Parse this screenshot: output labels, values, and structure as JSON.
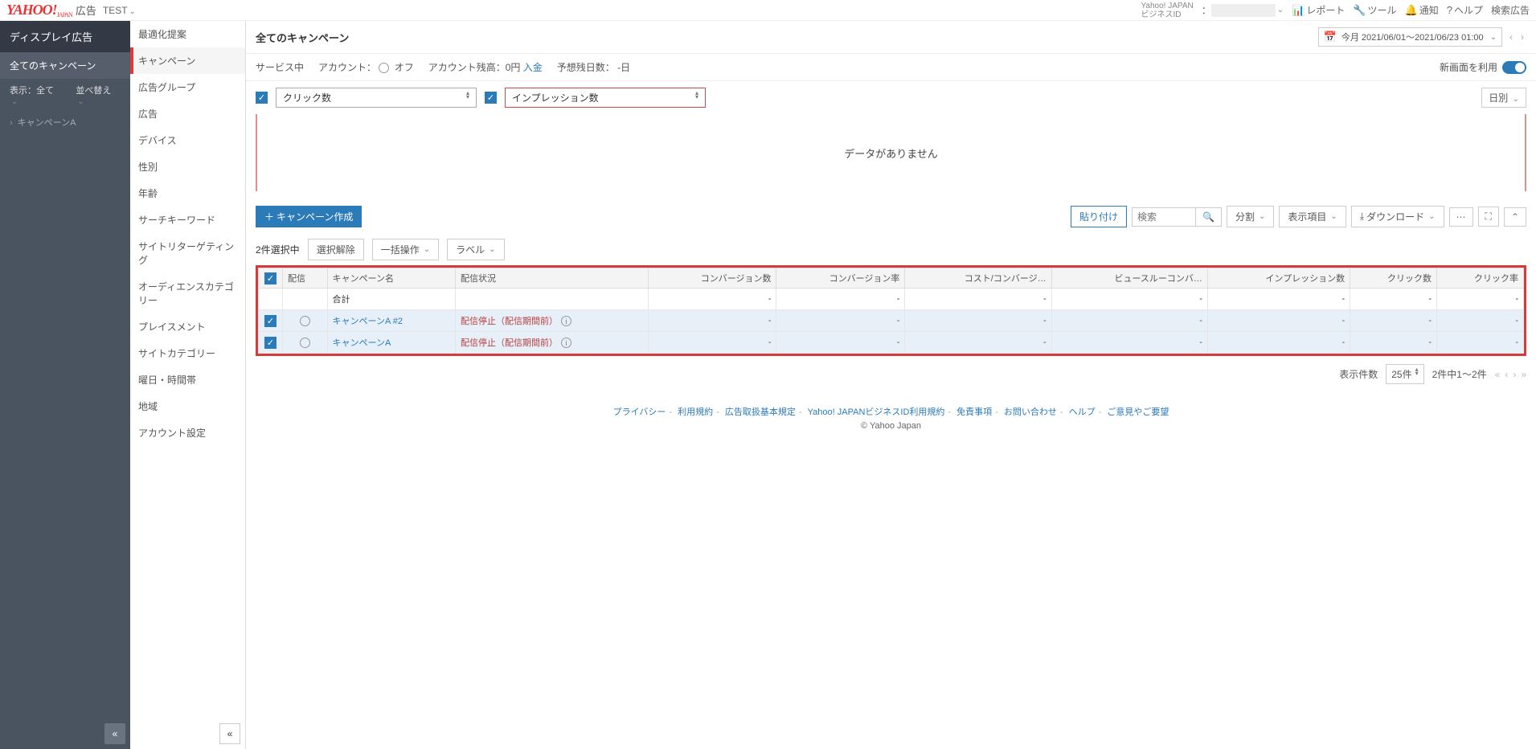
{
  "header": {
    "logo_main": "YAHOO!",
    "logo_sub": "JAPAN",
    "logo_ad": "広告",
    "account_name": "TEST",
    "id_label1": "Yahoo! JAPAN",
    "id_label2": "ビジネスID",
    "links": {
      "report": "レポート",
      "tools": "ツール",
      "notif": "通知",
      "help": "ヘルプ",
      "search_ads": "検索広告"
    }
  },
  "sidebar1": {
    "title": "ディスプレイ広告",
    "subtitle": "全てのキャンペーン",
    "display_label": "表示：全て",
    "sort_label": "並べ替え",
    "breadcrumb": "キャンペーンA"
  },
  "sidebar2": {
    "items": [
      "最適化提案",
      "キャンペーン",
      "広告グループ",
      "広告",
      "デバイス",
      "性別",
      "年齢",
      "サーチキーワード",
      "サイトリターゲティング",
      "オーディエンスカテゴリー",
      "プレイスメント",
      "サイトカテゴリー",
      "曜日・時間帯",
      "地域",
      "アカウント設定"
    ],
    "active_index": 1
  },
  "main": {
    "title": "全てのキャンペーン",
    "date_range": "今月 2021/06/01～2021/06/23 01:00",
    "status": {
      "service": "サービス中",
      "account_label": "アカウント：",
      "account_state": "オフ",
      "balance_label": "アカウント残高：0円",
      "deposit": "入金",
      "remaining": "予想残日数： -日",
      "new_ui": "新画面を利用"
    },
    "metrics": {
      "m1": "クリック数",
      "m2": "インプレッション数",
      "period": "日別"
    },
    "chart_empty": "データがありません",
    "toolbar": {
      "create": "キャンペーン作成",
      "paste": "貼り付け",
      "search_placeholder": "検索",
      "split": "分割",
      "columns": "表示項目",
      "download": "ダウンロード"
    },
    "selection": {
      "count": "2件選択中",
      "deselect": "選択解除",
      "bulk": "一括操作",
      "label": "ラベル"
    },
    "table": {
      "headers": [
        "配信",
        "キャンペーン名",
        "配信状況",
        "コンバージョン数",
        "コンバージョン率",
        "コスト/コンバージ…",
        "ビュースルーコンバ…",
        "インプレッション数",
        "クリック数",
        "クリック率"
      ],
      "total_label": "合計",
      "rows": [
        {
          "name": "キャンペーンA #2",
          "status": "配信停止（配信期間前）"
        },
        {
          "name": "キャンペーンA",
          "status": "配信停止（配信期間前）"
        }
      ]
    },
    "pagination": {
      "size_label": "表示件数",
      "size_value": "25件",
      "info": "2件中1～2件"
    }
  },
  "footer": {
    "links": [
      "プライバシー",
      "利用規約",
      "広告取扱基本規定",
      "Yahoo! JAPANビジネスID利用規約",
      "免責事項",
      "お問い合わせ",
      "ヘルプ",
      "ご意見やご要望"
    ],
    "copyright": "© Yahoo Japan"
  }
}
